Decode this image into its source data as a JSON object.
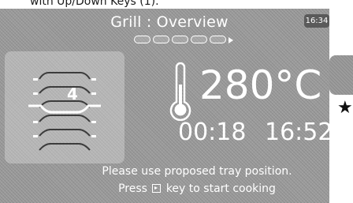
{
  "caption": "with Up/Down Keys (1).",
  "header": {
    "title": "Grill : Overview",
    "clock": "16:34",
    "progress_steps": 5
  },
  "tray": {
    "position": "4",
    "levels": 5
  },
  "cooking": {
    "temperature": "280°C",
    "cook_time": "00:18",
    "end_time": "16:52"
  },
  "messages": {
    "line1": "Please use proposed tray position.",
    "line2_before": "Press",
    "line2_after": "key to start cooking"
  },
  "icons": {
    "thermometer": "thermometer-icon",
    "tray": "oven-tray-icon",
    "start_key": "start-key-icon",
    "star": "star-icon"
  },
  "colors": {
    "screen_bg": "#9c9c9c",
    "foreground": "#ffffff",
    "clock_badge": "#5a5a5a"
  }
}
